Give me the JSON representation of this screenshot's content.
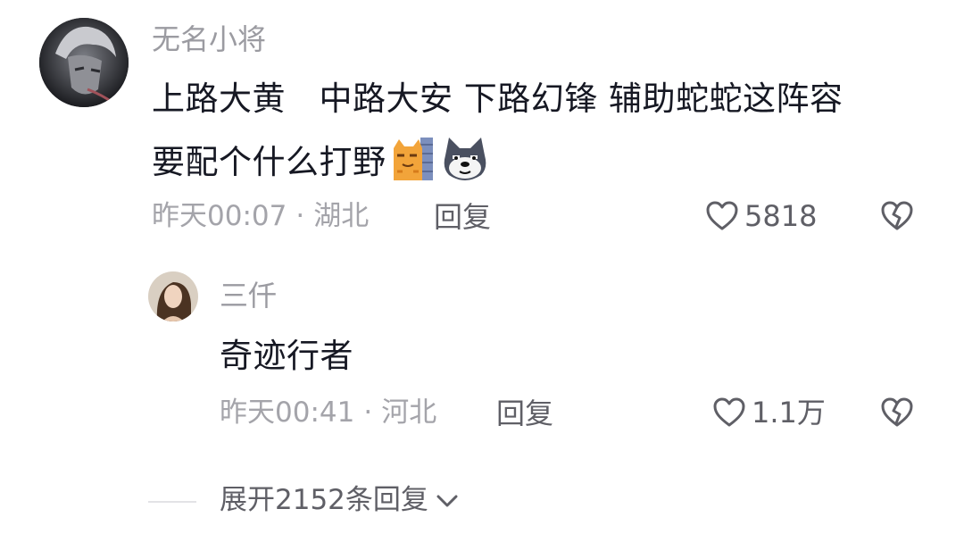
{
  "comment": {
    "username": "无名小将",
    "text_line1": "上路大黄　中路大安  下路幻锋  辅助蛇蛇这阵容",
    "text_line2": "要配个什么打野",
    "emojis": [
      "cat-peeking-emoji",
      "husky-dog-emoji"
    ],
    "time": "昨天00:07",
    "location": "湖北",
    "separator": "·",
    "reply_label": "回复",
    "like_count": "5818"
  },
  "reply": {
    "username": "三仟",
    "text": "奇迹行者",
    "time": "昨天00:41",
    "location": "河北",
    "separator": "·",
    "reply_label": "回复",
    "like_count": "1.1万"
  },
  "expand": {
    "label": "展开2152条回复"
  },
  "icons": {
    "like": "heart-outline-icon",
    "dislike": "broken-heart-icon",
    "expand": "chevron-down-icon"
  },
  "colors": {
    "username": "#9b9ba1",
    "text": "#161823",
    "meta": "#a4a4aa",
    "action": "#5f5f66"
  }
}
